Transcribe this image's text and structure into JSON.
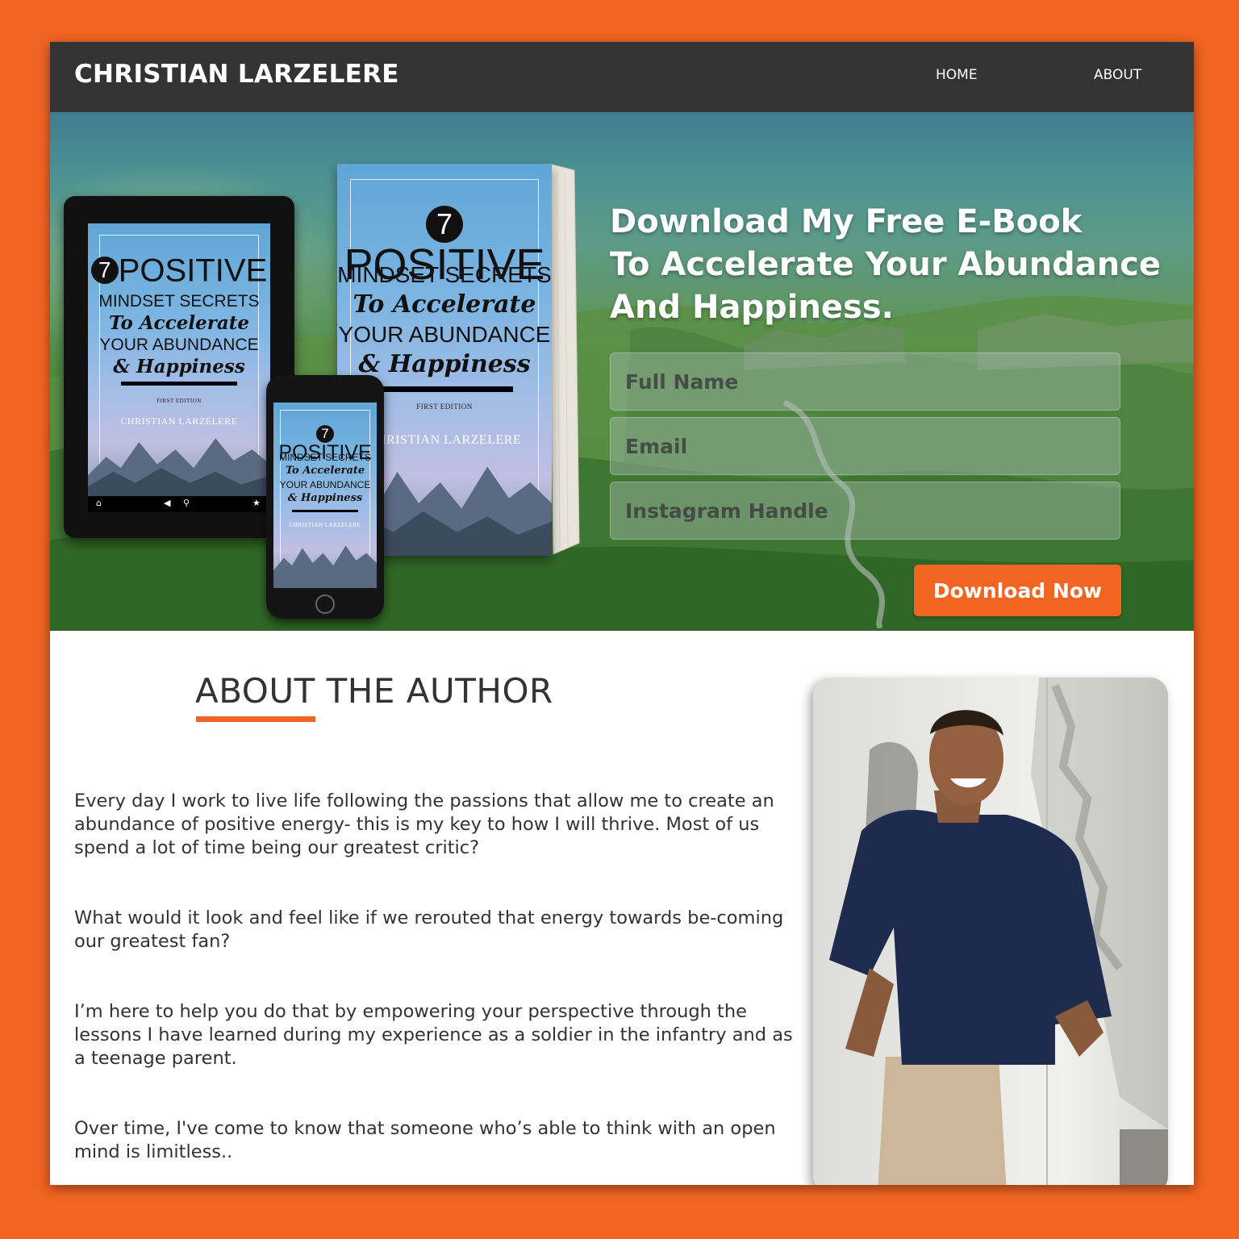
{
  "header": {
    "brand": "CHRISTIAN LARZELERE",
    "nav": {
      "home": "HOME",
      "about": "ABOUT"
    }
  },
  "hero": {
    "title_lines": [
      "Download My Free E-Book",
      "To Accelerate Your Abundance",
      "And Happiness."
    ],
    "form": {
      "full_name_placeholder": "Full Name",
      "email_placeholder": "Email",
      "instagram_placeholder": "Instagram Handle",
      "submit_label": "Download Now"
    },
    "book_cover": {
      "number": "7",
      "word": "POSITIVE",
      "line2": "MINDSET SECRETS",
      "line3": "To Accelerate",
      "line4": "YOUR ABUNDANCE",
      "line5": "& Happiness",
      "edition": "FIRST EDITION",
      "author": "CHRISTIAN LARZELERE"
    }
  },
  "about": {
    "heading": "ABOUT THE AUTHOR",
    "paragraphs": [
      "Every day I work to live life following the passions that allow me to create an abundance of positive energy- this is my key to how I will thrive. Most of us spend a lot of time being our greatest critic?",
      "What would it look and feel like if we rerouted that energy towards be-coming our greatest fan?",
      "I’m here to help you do that by empowering your perspective through the lessons I have learned during my experience as a soldier in the infantry and as a teenage parent.",
      "Over time, I've come to know that someone who’s able to think with an open mind is limitless.."
    ]
  },
  "colors": {
    "accent": "#f26422",
    "header_bg": "#333333",
    "text": "#333333"
  }
}
